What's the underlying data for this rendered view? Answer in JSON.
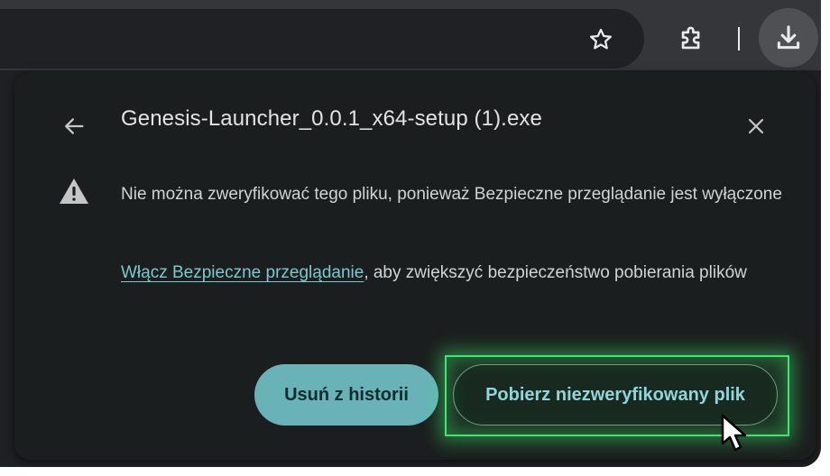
{
  "toolbar": {
    "bookmark_icon": "star-icon",
    "extensions_icon": "puzzle-icon",
    "downloads_icon": "download-icon"
  },
  "popup": {
    "file_name": "Genesis-Launcher_0.0.1_x64-setup (1).exe",
    "back_icon": "arrow-left-icon",
    "close_icon": "close-icon",
    "warning_icon": "warning-triangle-icon",
    "warning_text": "Nie można zweryfikować tego pliku, ponieważ Bezpieczne przeglądanie jest wyłączone",
    "enable_link": "Włącz Bezpieczne przeglądanie",
    "enable_suffix": ", aby zwiększyć bezpieczeństwo pobierania plików",
    "remove_button": "Usuń z historii",
    "download_button": "Pobierz niezweryfikowany plik"
  },
  "colors": {
    "accent_teal": "#69b3b8",
    "link": "#7cc9cf",
    "highlight_green": "#3ee86c",
    "popup_bg": "#1b1e1e"
  }
}
